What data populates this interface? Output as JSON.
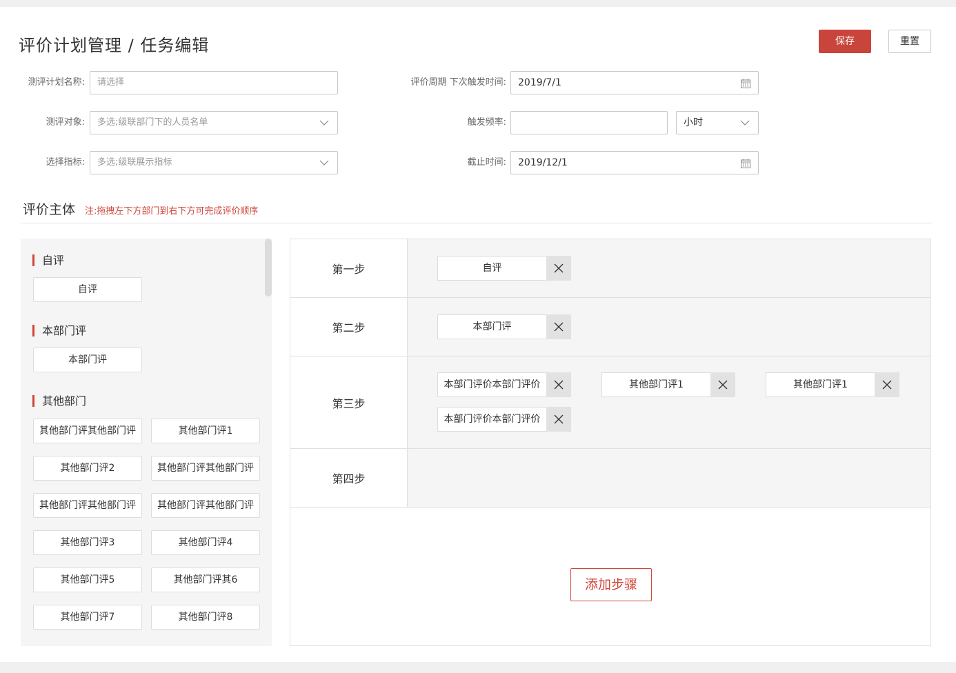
{
  "header": {
    "title": "评价计划管理 / 任务编辑",
    "save_label": "保存",
    "reset_label": "重置"
  },
  "form": {
    "plan_name": {
      "label": "测评计划名称:",
      "placeholder": "请选择"
    },
    "target": {
      "label": "测评对象:",
      "placeholder": "多选;级联部门下的人员名单"
    },
    "indicator": {
      "label": "选择指标:",
      "placeholder": "多选;级联展示指标"
    },
    "next_trigger": {
      "label": "评价周期 下次触发时间:",
      "value": "2019/7/1"
    },
    "frequency": {
      "label": "触发频率:",
      "value": "",
      "unit": "小时"
    },
    "deadline": {
      "label": "截止时间:",
      "value": "2019/12/1"
    }
  },
  "section": {
    "title": "评价主体",
    "note": "注:拖拽左下方部门到右下方可完成评价顺序"
  },
  "left_groups": [
    {
      "title": "自评",
      "items": [
        "自评"
      ]
    },
    {
      "title": "本部门评",
      "items": [
        "本部门评"
      ]
    },
    {
      "title": "其他部门",
      "items": [
        "其他部门评其他部门评",
        "其他部门评1",
        "其他部门评2",
        "其他部门评其他部门评",
        "其他部门评其他部门评",
        "其他部门评其他部门评",
        "其他部门评3",
        "其他部门评4",
        "其他部门评5",
        "其他部门评其6",
        "其他部门评7",
        "其他部门评8"
      ]
    }
  ],
  "steps": [
    {
      "label": "第一步",
      "tags": [
        "自评"
      ]
    },
    {
      "label": "第二步",
      "tags": [
        "本部门评"
      ]
    },
    {
      "label": "第三步",
      "tags": [
        "本部门评价本部门评价",
        "其他部门评1",
        "其他部门评1",
        "本部门评价本部门评价"
      ]
    },
    {
      "label": "第四步",
      "tags": []
    }
  ],
  "add_step_label": "添加步骤",
  "icons": {
    "dropdown": "chevron-down-icon",
    "calendar": "calendar-icon",
    "remove": "close-icon"
  },
  "colors": {
    "accent": "#c9453b"
  }
}
